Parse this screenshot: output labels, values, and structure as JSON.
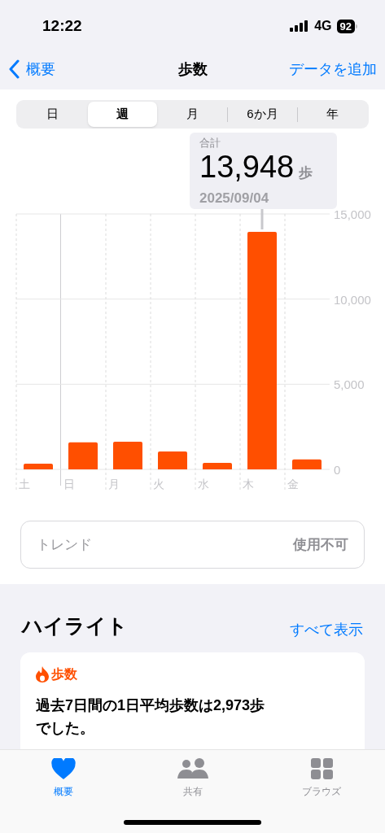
{
  "status_bar": {
    "time": "12:22",
    "network": "4G",
    "battery": "92"
  },
  "nav": {
    "back": "概要",
    "title": "歩数",
    "action": "データを追加"
  },
  "segments": [
    {
      "label": "日",
      "selected": false
    },
    {
      "label": "週",
      "selected": true
    },
    {
      "label": "月",
      "selected": false
    },
    {
      "label": "6か月",
      "selected": false
    },
    {
      "label": "年",
      "selected": false
    }
  ],
  "tooltip": {
    "label": "合計",
    "value": "13,948",
    "unit": "歩",
    "date": "2025/09/04"
  },
  "chart": {
    "chart_data": {
      "type": "bar",
      "categories": [
        "土",
        "日",
        "月",
        "火",
        "水",
        "木",
        "金"
      ],
      "series": [
        {
          "color": "#ff4f00",
          "values": [
            330,
            1590,
            1620,
            1050,
            380,
            13948,
            590
          ]
        }
      ],
      "ylim": [
        0,
        15000
      ],
      "yticks": [
        {
          "value": 0,
          "label": "0"
        },
        {
          "value": 5000,
          "label": "5,000"
        },
        {
          "value": 10000,
          "label": "10,000"
        },
        {
          "value": 15000,
          "label": "15,000"
        }
      ]
    }
  },
  "trend": {
    "label": "トレンド",
    "value": "使用不可"
  },
  "highlights": {
    "title": "ハイライト",
    "link": "すべて表示",
    "card": {
      "category": "歩数",
      "text": "過去7日間の1日平均歩数は2,973歩でした。"
    }
  },
  "tab_bar": [
    {
      "kind": "heart",
      "label": "概要",
      "selected": true
    },
    {
      "kind": "people",
      "label": "共有",
      "selected": false
    },
    {
      "kind": "grid",
      "label": "ブラウズ",
      "selected": false
    }
  ]
}
